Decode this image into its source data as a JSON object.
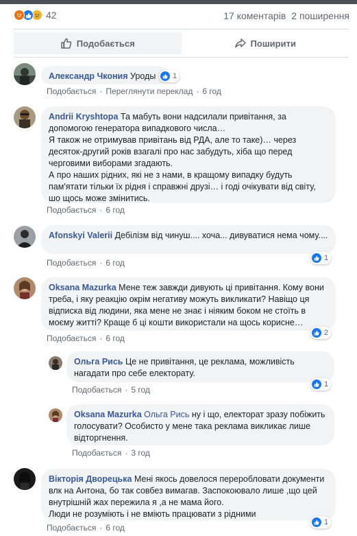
{
  "stats": {
    "reaction_icons": [
      "angry-icon",
      "like-icon",
      "sad-icon"
    ],
    "reaction_count": "42",
    "comments": "17 коментарів",
    "shares": "2 поширення"
  },
  "actions": {
    "like_label": "Подобається",
    "share_label": "Поширити"
  },
  "comments": [
    {
      "author": "Александр Чкония",
      "text": "Уроды",
      "like": "Подобається",
      "translate": "Переглянути переклад",
      "time": "6 год",
      "likes": "1"
    },
    {
      "author": "Andrii Kryshtopa",
      "text": "Та мабуть вони надсилали привітання, за допомогою генератора випадкового числа…",
      "line2": "Я також не отримував привітань від РДА, але то таке)… через десяток-другий років взагалі про нас забудуть, хіба що перед черговими виборами згадають.",
      "line3": "А про наших рідних, які не з нами, в кращому випадку будуть пам'ятати тільки їх рідня і справжні друзі… і годі очікувати від світу, шо щось може змінитись.",
      "like": "Подобається",
      "time": "6 год"
    },
    {
      "author": "Afonskyi Valerii",
      "text": "Дебілізм від чинуш.... хоча... дивуватися нема чому....",
      "like": "Подобається",
      "time": "6 год",
      "likes": "1"
    },
    {
      "author": "Oksana Mazurka",
      "text": "Мене теж завжди дивують ці привітання. Кому вони треба, і яку реакцію окрім негативу можуть викликати? Навіщо ця відписка від людини, яка мене не знає і ніяким боком не стоїть в моєму житті? Краще б ці кошти використали на щось корисне…",
      "like": "Подобається",
      "time": "6 год",
      "likes": "2"
    },
    {
      "author": "Ольга Рись",
      "text": "Це не привітання, це реклама, можливість нагадати про себе електорату.",
      "like": "Подобається",
      "time": "5 год",
      "likes": "1"
    },
    {
      "author": "Oksana Mazurka",
      "mention": "Ольга Рись",
      "text": "ну і що, електорат зразу побіжить голосувати? Особисто у мене така реклама викликає лише відторгнення.",
      "like": "Подобається",
      "time": "3 год"
    },
    {
      "author": "Вікторія Дворецька",
      "text": "Мені якось довелося переробловати документи влк на Антона, бо так совбез вимагав. Заспокоювало лише ,що цей внутрішній жах пережила я ,а не мама його.",
      "line2": "Люди не розуміють і не вміють працювати з рідними",
      "like": "Подобається",
      "time": "6 год",
      "likes": "1"
    }
  ]
}
